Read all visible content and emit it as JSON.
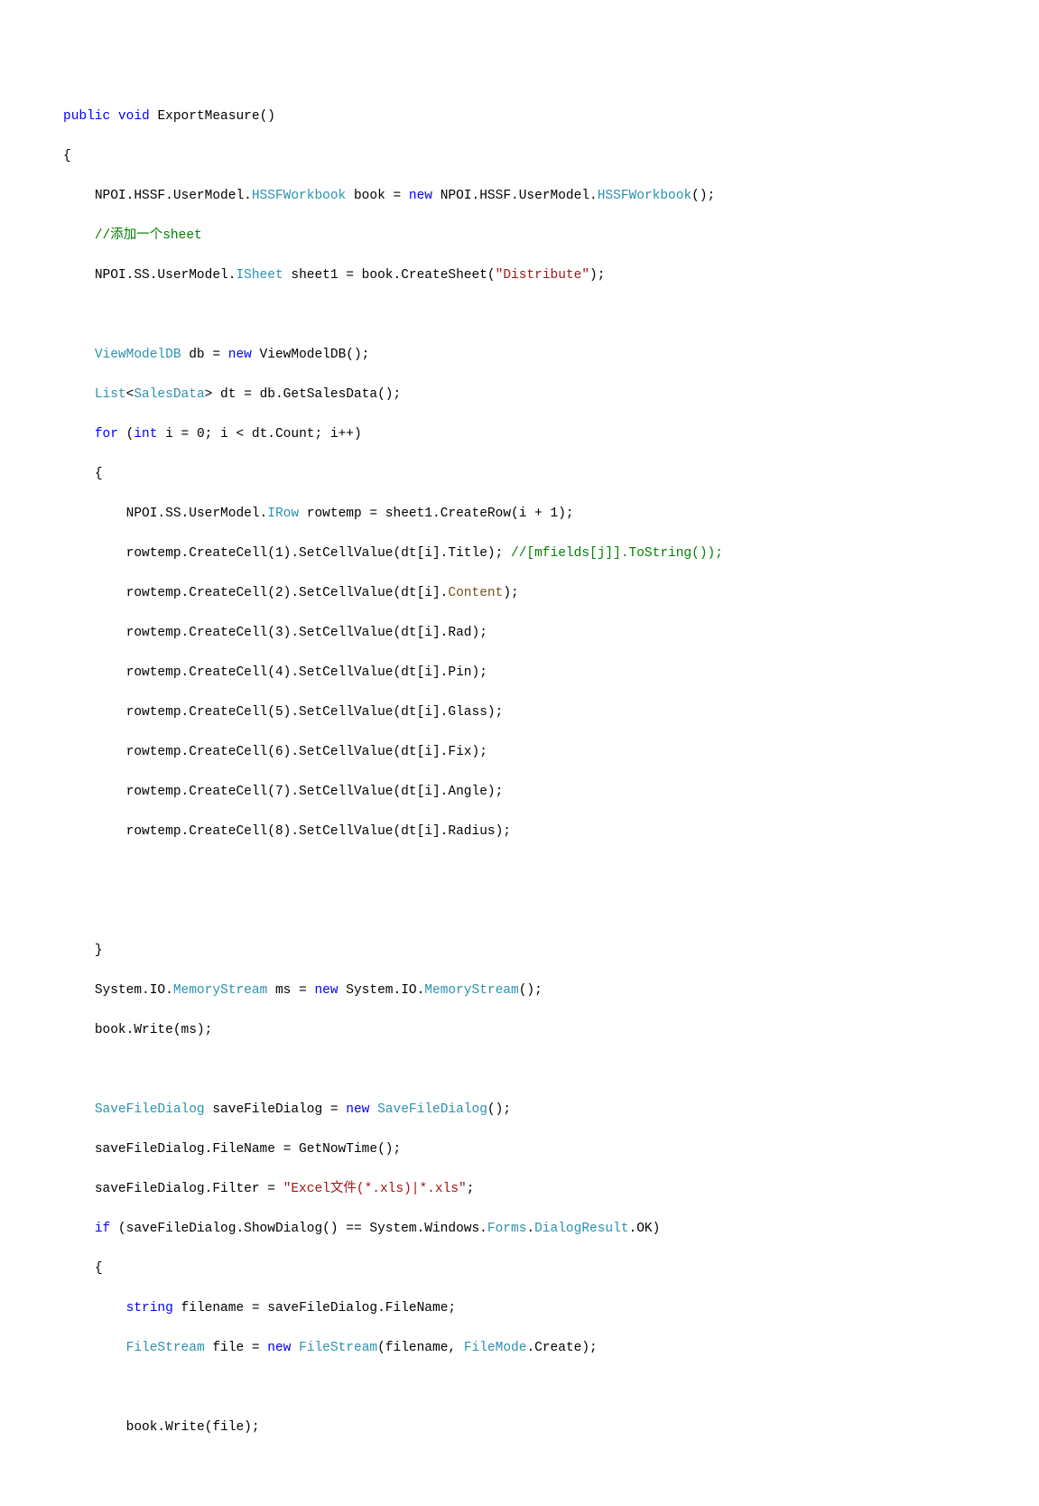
{
  "code": {
    "line1": {
      "public": "public",
      "void": "void",
      "method": "ExportMeasure",
      "parens": "()"
    },
    "line2": {
      "brace": "{"
    },
    "line3": {
      "ns1": "NPOI.HSSF.UserModel.",
      "type1": "HSSFWorkbook",
      "var": " book = ",
      "new": "new",
      "ns2": " NPOI.HSSF.UserModel.",
      "type2": "HSSFWorkbook",
      "end": "();"
    },
    "line4": {
      "comment": "//添加一个sheet"
    },
    "line5": {
      "ns1": "NPOI.SS.UserModel.",
      "type1": "ISheet",
      "var": " sheet1 = book.CreateSheet(",
      "str": "\"Distribute\"",
      "end": ");"
    },
    "line7": {
      "type1": "ViewModelDB",
      "var": " db = ",
      "new": "new",
      "type2": " ViewModelDB",
      "end": "();"
    },
    "line8": {
      "type1": "List",
      "lt": "<",
      "type2": "SalesData",
      "gt": ">",
      "var": " dt = db.GetSalesData();"
    },
    "line9": {
      "for": "for",
      "sp1": " (",
      "int": "int",
      "init": " i = ",
      "zero": "0",
      "cond": "; i < dt.Count; i++)"
    },
    "line10": {
      "brace": "{"
    },
    "line11": {
      "ns1": "NPOI.SS.UserModel.",
      "type1": "IRow",
      "var": " rowtemp = sheet1.CreateRow(i + ",
      "num": "1",
      "end": ");"
    },
    "line12": {
      "p1": "rowtemp.CreateCell(",
      "n1": "1",
      "p2": ").SetCellValue(dt[i].Title); ",
      "comment": "//[mfields[j]].ToString());"
    },
    "line13": {
      "p1": "rowtemp.CreateCell(",
      "n1": "2",
      "p2": ").SetCellValue(dt[i].",
      "prop": "Content",
      "end": ");"
    },
    "line14": {
      "p1": "rowtemp.CreateCell(",
      "n1": "3",
      "p2": ").SetCellValue(dt[i].Rad);"
    },
    "line15": {
      "p1": "rowtemp.CreateCell(",
      "n1": "4",
      "p2": ").SetCellValue(dt[i].Pin);"
    },
    "line16": {
      "p1": "rowtemp.CreateCell(",
      "n1": "5",
      "p2": ").SetCellValue(dt[i].Glass);"
    },
    "line17": {
      "p1": "rowtemp.CreateCell(",
      "n1": "6",
      "p2": ").SetCellValue(dt[i].Fix);"
    },
    "line18": {
      "p1": "rowtemp.CreateCell(",
      "n1": "7",
      "p2": ").SetCellValue(dt[i].Angle);"
    },
    "line19": {
      "p1": "rowtemp.CreateCell(",
      "n1": "8",
      "p2": ").SetCellValue(dt[i].Radius);"
    },
    "line22": {
      "brace": "}"
    },
    "line23": {
      "p1": "System.IO.",
      "type1": "MemoryStream",
      "var": " ms = ",
      "new": "new",
      "p2": " System.IO.",
      "type2": "MemoryStream",
      "end": "();"
    },
    "line24": {
      "text": "book.Write(ms);"
    },
    "line26": {
      "type1": "SaveFileDialog",
      "var": " saveFileDialog = ",
      "new": "new",
      "sp": " ",
      "type2": "SaveFileDialog",
      "end": "();"
    },
    "line27": {
      "text": "saveFileDialog.FileName = GetNowTime();"
    },
    "line28": {
      "p1": "saveFileDialog.Filter = ",
      "str": "\"Excel文件(*.xls)|*.xls\"",
      "end": ";"
    },
    "line29": {
      "if": "if",
      "p1": " (saveFileDialog.ShowDialog() == System.Windows.",
      "type1": "Forms",
      "p2": ".",
      "type2": "DialogResult",
      "p3": ".OK)"
    },
    "line30": {
      "brace": "{"
    },
    "line31": {
      "string": "string",
      "var": " filename = saveFileDialog.FileName;"
    },
    "line32": {
      "type1": "FileStream",
      "var": " file = ",
      "new": "new",
      "sp": " ",
      "type2": "FileStream",
      "p1": "(filename, ",
      "type3": "FileMode",
      "end": ".Create);"
    },
    "line34": {
      "text": "book.Write(file);"
    }
  }
}
